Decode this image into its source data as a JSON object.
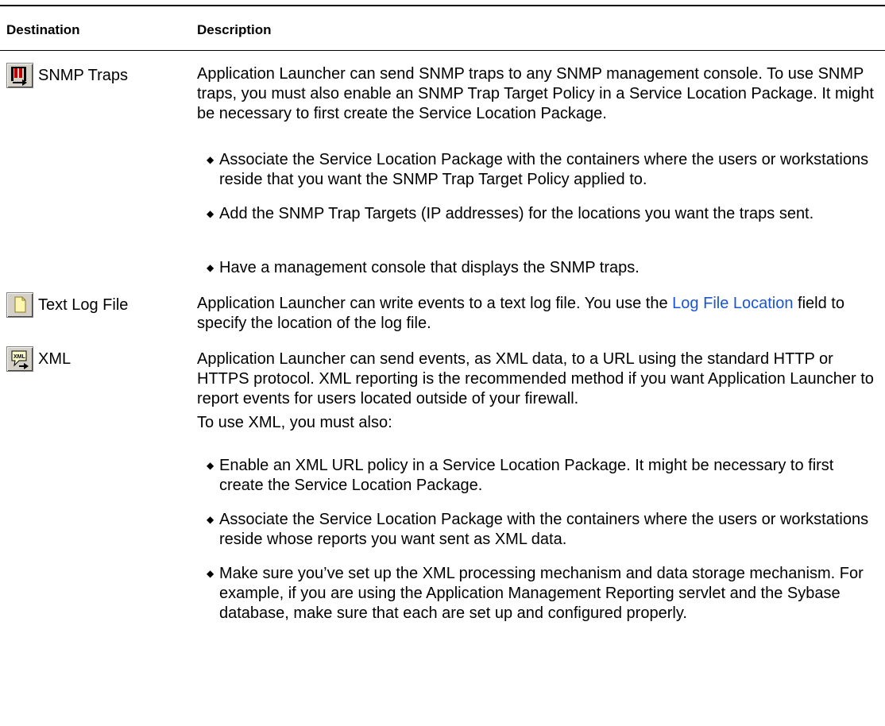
{
  "table": {
    "headers": {
      "destination": "Destination",
      "description": "Description"
    },
    "snmp": {
      "name": "SNMP Traps",
      "icon": "snmp-trap-icon",
      "intro": "Application Launcher can send SNMP traps to any SNMP management console. To use SNMP traps, you must also enable an SNMP Trap Target Policy in a Service Location Package. It might be necessary to first create the Service Location Package.",
      "bullets": [
        "Associate the Service Location Package with the containers where the users or workstations reside that you want the SNMP Trap Target Policy applied to.",
        "Add the SNMP Trap Targets (IP addresses) for the locations you want the traps sent.",
        "Have a management console that displays the SNMP traps."
      ]
    },
    "textlog": {
      "name": "Text Log File",
      "icon": "text-log-file-icon",
      "pre": "Application Launcher can write events to a text log file. You use the ",
      "link": "Log File Location",
      "post": " field to specify the location of the log file."
    },
    "xml": {
      "name": "XML",
      "icon": "xml-icon",
      "intro": "Application Launcher can send events, as XML data, to a URL using the standard HTTP or HTTPS protocol. XML reporting is the recommended method if you want Application Launcher to report events for users located outside of your firewall.",
      "lead": "To use XML, you must also:",
      "bullets": [
        "Enable an XML URL policy in a Service Location Package. It might be necessary to first create the Service Location Package.",
        "Associate the Service Location Package with the containers where the users or workstations reside whose reports you want sent as XML data.",
        "Make sure you’ve set up the XML processing mechanism and data storage mechanism. For example, if you are using the Application Management Reporting servlet and the Sybase database, make sure that each are set up and configured properly."
      ]
    }
  }
}
